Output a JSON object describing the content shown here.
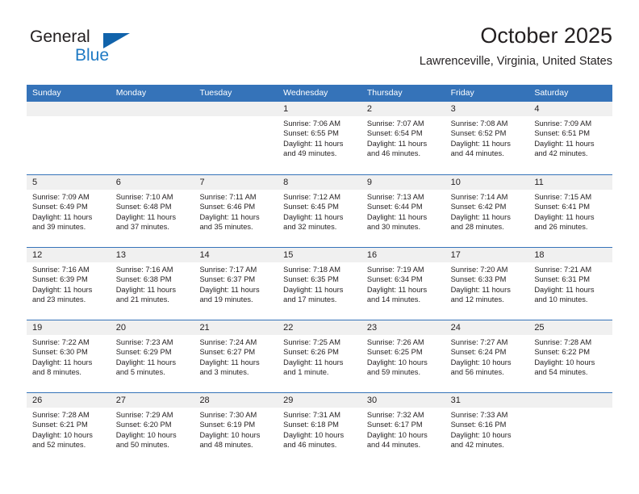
{
  "brand": {
    "name_part1": "General",
    "name_part2": "Blue",
    "triangle_color": "#1163ab",
    "blue_text_color": "#1f7ac4"
  },
  "header": {
    "title": "October 2025",
    "subtitle": "Lawrenceville, Virginia, United States"
  },
  "colors": {
    "header_blue": "#3573b9",
    "day_band_gray": "#f0f0f0",
    "text": "#231f20"
  },
  "weekdays": [
    "Sunday",
    "Monday",
    "Tuesday",
    "Wednesday",
    "Thursday",
    "Friday",
    "Saturday"
  ],
  "labels": {
    "sunrise_prefix": "Sunrise:",
    "sunset_prefix": "Sunset:",
    "daylight_prefix": "Daylight:"
  },
  "weeks": [
    [
      {
        "day": "",
        "sunrise": "",
        "sunset": "",
        "daylight_line1": "",
        "daylight_line2": ""
      },
      {
        "day": "",
        "sunrise": "",
        "sunset": "",
        "daylight_line1": "",
        "daylight_line2": ""
      },
      {
        "day": "",
        "sunrise": "",
        "sunset": "",
        "daylight_line1": "",
        "daylight_line2": ""
      },
      {
        "day": "1",
        "sunrise": "Sunrise: 7:06 AM",
        "sunset": "Sunset: 6:55 PM",
        "daylight_line1": "Daylight: 11 hours",
        "daylight_line2": "and 49 minutes."
      },
      {
        "day": "2",
        "sunrise": "Sunrise: 7:07 AM",
        "sunset": "Sunset: 6:54 PM",
        "daylight_line1": "Daylight: 11 hours",
        "daylight_line2": "and 46 minutes."
      },
      {
        "day": "3",
        "sunrise": "Sunrise: 7:08 AM",
        "sunset": "Sunset: 6:52 PM",
        "daylight_line1": "Daylight: 11 hours",
        "daylight_line2": "and 44 minutes."
      },
      {
        "day": "4",
        "sunrise": "Sunrise: 7:09 AM",
        "sunset": "Sunset: 6:51 PM",
        "daylight_line1": "Daylight: 11 hours",
        "daylight_line2": "and 42 minutes."
      }
    ],
    [
      {
        "day": "5",
        "sunrise": "Sunrise: 7:09 AM",
        "sunset": "Sunset: 6:49 PM",
        "daylight_line1": "Daylight: 11 hours",
        "daylight_line2": "and 39 minutes."
      },
      {
        "day": "6",
        "sunrise": "Sunrise: 7:10 AM",
        "sunset": "Sunset: 6:48 PM",
        "daylight_line1": "Daylight: 11 hours",
        "daylight_line2": "and 37 minutes."
      },
      {
        "day": "7",
        "sunrise": "Sunrise: 7:11 AM",
        "sunset": "Sunset: 6:46 PM",
        "daylight_line1": "Daylight: 11 hours",
        "daylight_line2": "and 35 minutes."
      },
      {
        "day": "8",
        "sunrise": "Sunrise: 7:12 AM",
        "sunset": "Sunset: 6:45 PM",
        "daylight_line1": "Daylight: 11 hours",
        "daylight_line2": "and 32 minutes."
      },
      {
        "day": "9",
        "sunrise": "Sunrise: 7:13 AM",
        "sunset": "Sunset: 6:44 PM",
        "daylight_line1": "Daylight: 11 hours",
        "daylight_line2": "and 30 minutes."
      },
      {
        "day": "10",
        "sunrise": "Sunrise: 7:14 AM",
        "sunset": "Sunset: 6:42 PM",
        "daylight_line1": "Daylight: 11 hours",
        "daylight_line2": "and 28 minutes."
      },
      {
        "day": "11",
        "sunrise": "Sunrise: 7:15 AM",
        "sunset": "Sunset: 6:41 PM",
        "daylight_line1": "Daylight: 11 hours",
        "daylight_line2": "and 26 minutes."
      }
    ],
    [
      {
        "day": "12",
        "sunrise": "Sunrise: 7:16 AM",
        "sunset": "Sunset: 6:39 PM",
        "daylight_line1": "Daylight: 11 hours",
        "daylight_line2": "and 23 minutes."
      },
      {
        "day": "13",
        "sunrise": "Sunrise: 7:16 AM",
        "sunset": "Sunset: 6:38 PM",
        "daylight_line1": "Daylight: 11 hours",
        "daylight_line2": "and 21 minutes."
      },
      {
        "day": "14",
        "sunrise": "Sunrise: 7:17 AM",
        "sunset": "Sunset: 6:37 PM",
        "daylight_line1": "Daylight: 11 hours",
        "daylight_line2": "and 19 minutes."
      },
      {
        "day": "15",
        "sunrise": "Sunrise: 7:18 AM",
        "sunset": "Sunset: 6:35 PM",
        "daylight_line1": "Daylight: 11 hours",
        "daylight_line2": "and 17 minutes."
      },
      {
        "day": "16",
        "sunrise": "Sunrise: 7:19 AM",
        "sunset": "Sunset: 6:34 PM",
        "daylight_line1": "Daylight: 11 hours",
        "daylight_line2": "and 14 minutes."
      },
      {
        "day": "17",
        "sunrise": "Sunrise: 7:20 AM",
        "sunset": "Sunset: 6:33 PM",
        "daylight_line1": "Daylight: 11 hours",
        "daylight_line2": "and 12 minutes."
      },
      {
        "day": "18",
        "sunrise": "Sunrise: 7:21 AM",
        "sunset": "Sunset: 6:31 PM",
        "daylight_line1": "Daylight: 11 hours",
        "daylight_line2": "and 10 minutes."
      }
    ],
    [
      {
        "day": "19",
        "sunrise": "Sunrise: 7:22 AM",
        "sunset": "Sunset: 6:30 PM",
        "daylight_line1": "Daylight: 11 hours",
        "daylight_line2": "and 8 minutes."
      },
      {
        "day": "20",
        "sunrise": "Sunrise: 7:23 AM",
        "sunset": "Sunset: 6:29 PM",
        "daylight_line1": "Daylight: 11 hours",
        "daylight_line2": "and 5 minutes."
      },
      {
        "day": "21",
        "sunrise": "Sunrise: 7:24 AM",
        "sunset": "Sunset: 6:27 PM",
        "daylight_line1": "Daylight: 11 hours",
        "daylight_line2": "and 3 minutes."
      },
      {
        "day": "22",
        "sunrise": "Sunrise: 7:25 AM",
        "sunset": "Sunset: 6:26 PM",
        "daylight_line1": "Daylight: 11 hours",
        "daylight_line2": "and 1 minute."
      },
      {
        "day": "23",
        "sunrise": "Sunrise: 7:26 AM",
        "sunset": "Sunset: 6:25 PM",
        "daylight_line1": "Daylight: 10 hours",
        "daylight_line2": "and 59 minutes."
      },
      {
        "day": "24",
        "sunrise": "Sunrise: 7:27 AM",
        "sunset": "Sunset: 6:24 PM",
        "daylight_line1": "Daylight: 10 hours",
        "daylight_line2": "and 56 minutes."
      },
      {
        "day": "25",
        "sunrise": "Sunrise: 7:28 AM",
        "sunset": "Sunset: 6:22 PM",
        "daylight_line1": "Daylight: 10 hours",
        "daylight_line2": "and 54 minutes."
      }
    ],
    [
      {
        "day": "26",
        "sunrise": "Sunrise: 7:28 AM",
        "sunset": "Sunset: 6:21 PM",
        "daylight_line1": "Daylight: 10 hours",
        "daylight_line2": "and 52 minutes."
      },
      {
        "day": "27",
        "sunrise": "Sunrise: 7:29 AM",
        "sunset": "Sunset: 6:20 PM",
        "daylight_line1": "Daylight: 10 hours",
        "daylight_line2": "and 50 minutes."
      },
      {
        "day": "28",
        "sunrise": "Sunrise: 7:30 AM",
        "sunset": "Sunset: 6:19 PM",
        "daylight_line1": "Daylight: 10 hours",
        "daylight_line2": "and 48 minutes."
      },
      {
        "day": "29",
        "sunrise": "Sunrise: 7:31 AM",
        "sunset": "Sunset: 6:18 PM",
        "daylight_line1": "Daylight: 10 hours",
        "daylight_line2": "and 46 minutes."
      },
      {
        "day": "30",
        "sunrise": "Sunrise: 7:32 AM",
        "sunset": "Sunset: 6:17 PM",
        "daylight_line1": "Daylight: 10 hours",
        "daylight_line2": "and 44 minutes."
      },
      {
        "day": "31",
        "sunrise": "Sunrise: 7:33 AM",
        "sunset": "Sunset: 6:16 PM",
        "daylight_line1": "Daylight: 10 hours",
        "daylight_line2": "and 42 minutes."
      },
      {
        "day": "",
        "sunrise": "",
        "sunset": "",
        "daylight_line1": "",
        "daylight_line2": ""
      }
    ]
  ]
}
